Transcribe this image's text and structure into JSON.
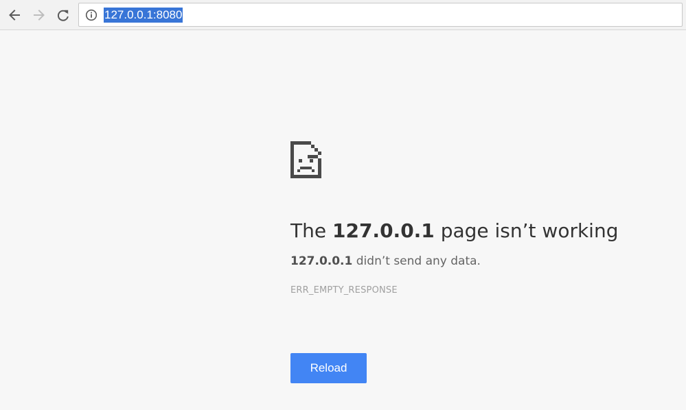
{
  "toolbar": {
    "back_icon": "arrow-left-icon",
    "forward_icon": "arrow-right-icon",
    "reload_icon": "reload-icon",
    "site_info_icon": "info-icon",
    "url": "127.0.0.1:8080",
    "url_selection_color": "#3875d7"
  },
  "error": {
    "icon": "sad-page-icon",
    "title_prefix": "The ",
    "title_host": "127.0.0.1",
    "title_suffix": " page isn’t working",
    "desc_host": "127.0.0.1",
    "desc_suffix": " didn’t send any data.",
    "code": "ERR_EMPTY_RESPONSE",
    "reload_label": "Reload",
    "reload_color": "#4285f4"
  }
}
